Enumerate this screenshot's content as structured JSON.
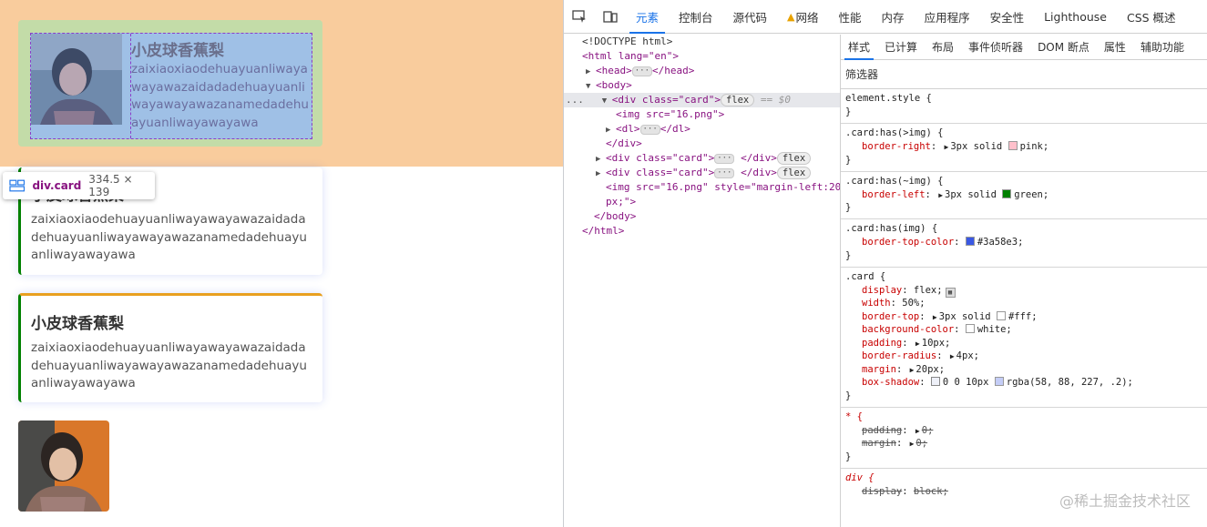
{
  "preview": {
    "cards": [
      {
        "title": "小皮球香蕉梨",
        "text": "zaixiaoxiaodehuayuanliwayawayawazaidadadehuayuanliwayawayawazanamedadehuayuanliwayawayawa"
      },
      {
        "title": "小皮球香蕉梨",
        "text": "zaixiaoxiaodehuayuanliwayawayawazaidadadehuayuanliwayawayawazanamedadehuayuanliwayawayawa"
      },
      {
        "title": "小皮球香蕉梨",
        "text": "zaixiaoxiaodehuayuanliwayawayawazaidadadehuayuanliwayawayawazanamedadehuayuanliwayawayawa"
      }
    ],
    "tooltip": {
      "name": "div.card",
      "size": "334.5 × 139"
    }
  },
  "devtools": {
    "tabs": [
      "元素",
      "控制台",
      "源代码",
      "网络",
      "性能",
      "内存",
      "应用程序",
      "安全性",
      "Lighthouse",
      "CSS 概述"
    ],
    "active_tab": "元素",
    "dom": {
      "doctype": "<!DOCTYPE html>",
      "html_open": "<html lang=\"en\">",
      "head": "<head>",
      "head_close": "</head>",
      "body": "<body>",
      "div_open_tag": "<div class=\"card\">",
      "flex_badge": "flex",
      "eq": "== $0",
      "img1": "<img src=\"16.png\">",
      "dl_open": "<dl>",
      "dl_close": "</dl>",
      "div_close": "</div>",
      "div2_open": "<div class=\"card\">",
      "div2_close": "</div>",
      "div3_open": "<div class=\"card\">",
      "div3_close": "</div>",
      "img2_line1": "<img src=\"16.png\" style=\"margin-left:20",
      "img2_line2": "px;\">",
      "body_close": "</body>",
      "html_close": "</html>",
      "ellipsis": "···",
      "row_dots": "..."
    },
    "style_tabs": [
      "样式",
      "已计算",
      "布局",
      "事件侦听器",
      "DOM 断点",
      "属性",
      "辅助功能"
    ],
    "filter_label": "筛选器",
    "rules": [
      {
        "selector": "element.style {",
        "props": []
      },
      {
        "selector": ".card:has(>img) {",
        "props": [
          {
            "name": "border-right",
            "value": "3px solid",
            "color": "pink",
            "color_hex": "#ffc0cb"
          }
        ]
      },
      {
        "selector": ".card:has(~img) {",
        "props": [
          {
            "name": "border-left",
            "value": "3px solid",
            "color": "green",
            "color_hex": "#008000"
          }
        ]
      },
      {
        "selector": ".card:has(img) {",
        "props": [
          {
            "name": "border-top-color",
            "value": "",
            "color": "#3a58e3",
            "color_hex": "#3a58e3"
          }
        ]
      },
      {
        "selector": ".card {",
        "props": [
          {
            "name": "display",
            "value": "flex;"
          },
          {
            "name": "width",
            "value": "50%;"
          },
          {
            "name": "border-top",
            "value": "3px solid",
            "color": "#fff",
            "color_hex": "#ffffff"
          },
          {
            "name": "background-color",
            "value": "",
            "color": "white",
            "color_hex": "#ffffff"
          },
          {
            "name": "padding",
            "value": "10px;"
          },
          {
            "name": "border-radius",
            "value": "4px;"
          },
          {
            "name": "margin",
            "value": "20px;"
          },
          {
            "name": "box-shadow",
            "value": "0 0 10px",
            "color": "rgba(58, 88, 227, .2)",
            "color_hex": "#c4cdf7"
          }
        ]
      },
      {
        "selector": "* {",
        "props": [
          {
            "name": "padding",
            "value": "0;",
            "struck": true
          },
          {
            "name": "margin",
            "value": "0;",
            "struck": true
          }
        ]
      },
      {
        "selector": "div {",
        "props": [
          {
            "name": "display",
            "value": "block;",
            "struck": true
          }
        ]
      }
    ],
    "watermark": "@稀土掘金技术社区"
  }
}
